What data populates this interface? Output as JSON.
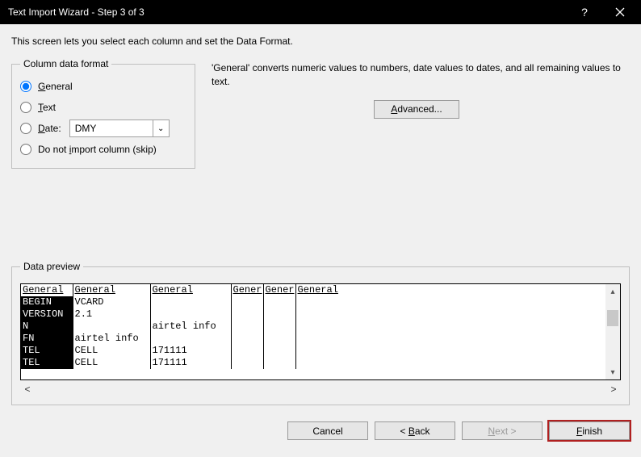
{
  "titlebar": {
    "title": "Text Import Wizard - Step 3 of 3"
  },
  "instruction": "This screen lets you select each column and set the Data Format.",
  "column_format": {
    "legend": "Column data format",
    "options": {
      "general": "General",
      "text": "Text",
      "date": "Date:",
      "skip": "Do not import column (skip)"
    },
    "date_value": "DMY"
  },
  "hint": "'General' converts numeric values to numbers, date values to dates, and all remaining values to text.",
  "buttons": {
    "advanced": "Advanced...",
    "cancel": "Cancel",
    "back": "< Back",
    "next": "Next >",
    "finish": "Finish"
  },
  "preview": {
    "legend": "Data preview",
    "headers": [
      "General",
      "General",
      "General",
      "Gener",
      "Gener",
      "General"
    ],
    "rows": [
      [
        "BEGIN",
        "VCARD",
        "",
        "",
        "",
        ""
      ],
      [
        "VERSION",
        "2.1",
        "",
        "",
        "",
        ""
      ],
      [
        "N",
        "",
        "airtel info",
        "",
        "",
        ""
      ],
      [
        "FN",
        "airtel info",
        "",
        "",
        "",
        ""
      ],
      [
        "TEL",
        "CELL",
        "171111",
        "",
        "",
        ""
      ],
      [
        "TEL",
        "CELL",
        "171111",
        "",
        "",
        ""
      ]
    ]
  }
}
